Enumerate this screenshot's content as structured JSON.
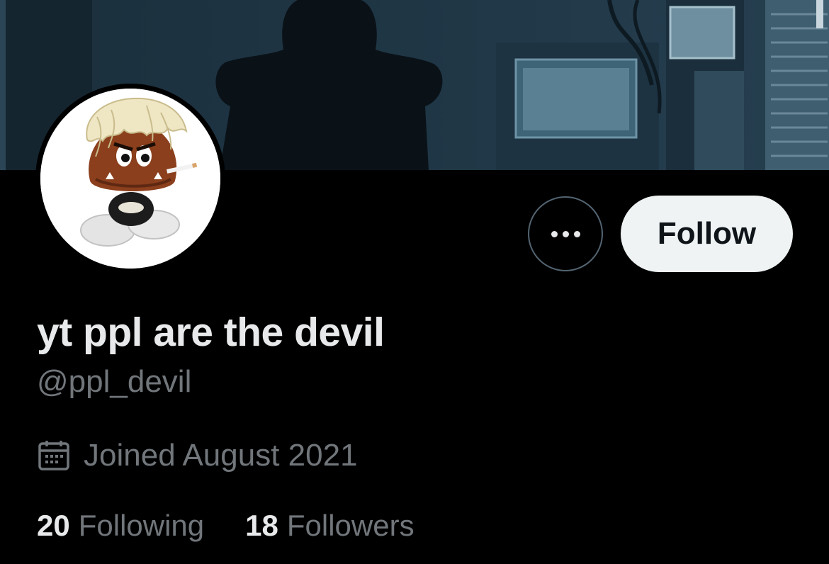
{
  "profile": {
    "display_name": "yt ppl are the devil",
    "handle": "@ppl_devil",
    "joined": "Joined August 2021"
  },
  "actions": {
    "more_icon": "more-horizontal-icon",
    "follow_label": "Follow"
  },
  "stats": {
    "following_count": "20",
    "following_label": "Following",
    "followers_count": "18",
    "followers_label": "Followers"
  },
  "icons": {
    "joined_icon": "calendar-icon"
  },
  "colors": {
    "background": "#000000",
    "primary_text": "#e7e9ea",
    "secondary_text": "#71767b",
    "follow_button_bg": "#eff3f4",
    "follow_button_text": "#0f1419",
    "outline": "#536471"
  }
}
